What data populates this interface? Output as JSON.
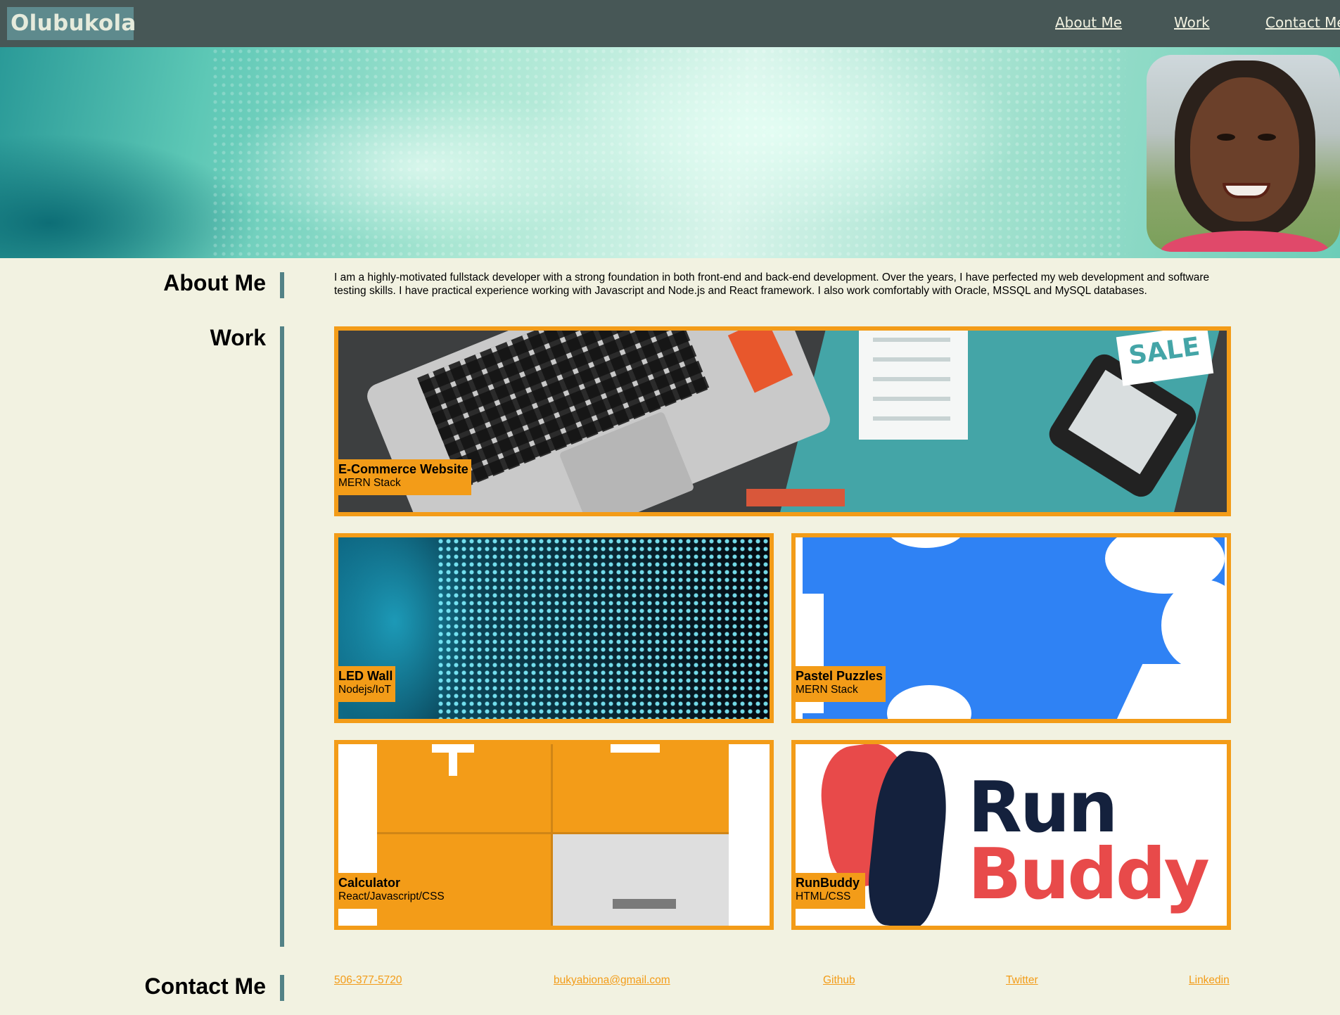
{
  "header": {
    "logo": "Olubukola",
    "nav": [
      "About Me",
      "Work",
      "Contact Me"
    ]
  },
  "about": {
    "title": "About Me",
    "text": "I am a highly-motivated fullstack developer with a strong foundation in both front-end and back-end development. Over the years, I have perfected my web development and software testing skills. I have practical experience working with Javascript and Node.js and React framework. I also work comfortably with Oracle, MSSQL and MySQL databases."
  },
  "work": {
    "title": "Work",
    "projects": [
      {
        "title": "E-Commerce Website",
        "stack": "MERN Stack"
      },
      {
        "title": "LED Wall",
        "stack": "Nodejs/IoT"
      },
      {
        "title": "Pastel Puzzles",
        "stack": "MERN Stack"
      },
      {
        "title": "Calculator",
        "stack": "React/Javascript/CSS"
      },
      {
        "title": "RunBuddy",
        "stack": "HTML/CSS"
      }
    ],
    "runbuddy_art": {
      "word1": "Run",
      "word2": "Buddy"
    },
    "ecommerce_art": {
      "sign": "SALE"
    }
  },
  "contact": {
    "title": "Contact Me",
    "links": [
      "506-377-5720",
      "bukyabiona@gmail.com",
      "Github",
      "Twitter",
      "Linkedin"
    ]
  },
  "colors": {
    "header_bg": "#475756",
    "logo_bg": "#5e8a8d",
    "page_bg": "#f2f2e1",
    "accent": "#f39c18",
    "divider": "#538286"
  },
  "icons": {
    "profile": "profile-photo"
  }
}
